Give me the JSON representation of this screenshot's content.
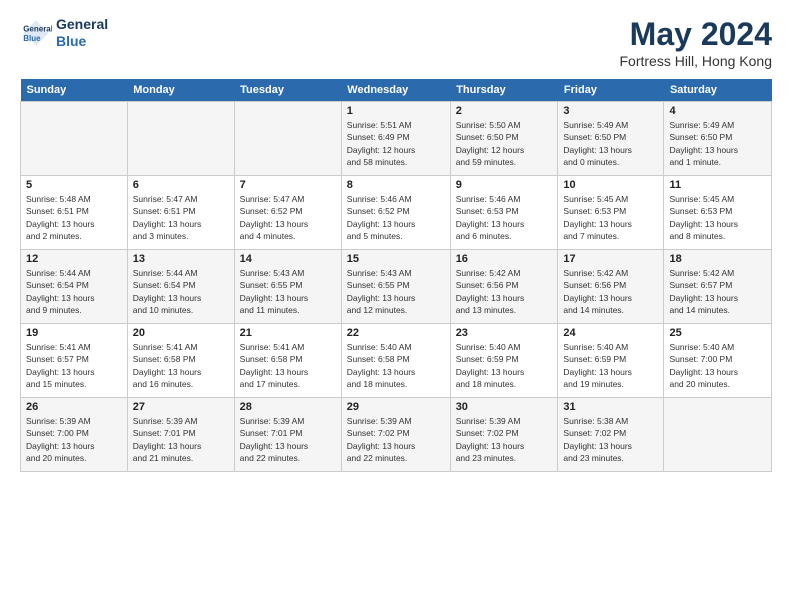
{
  "header": {
    "logo_line1": "General",
    "logo_line2": "Blue",
    "title": "May 2024",
    "location": "Fortress Hill, Hong Kong"
  },
  "weekdays": [
    "Sunday",
    "Monday",
    "Tuesday",
    "Wednesday",
    "Thursday",
    "Friday",
    "Saturday"
  ],
  "weeks": [
    [
      {
        "day": "",
        "info": ""
      },
      {
        "day": "",
        "info": ""
      },
      {
        "day": "",
        "info": ""
      },
      {
        "day": "1",
        "info": "Sunrise: 5:51 AM\nSunset: 6:49 PM\nDaylight: 12 hours\nand 58 minutes."
      },
      {
        "day": "2",
        "info": "Sunrise: 5:50 AM\nSunset: 6:50 PM\nDaylight: 12 hours\nand 59 minutes."
      },
      {
        "day": "3",
        "info": "Sunrise: 5:49 AM\nSunset: 6:50 PM\nDaylight: 13 hours\nand 0 minutes."
      },
      {
        "day": "4",
        "info": "Sunrise: 5:49 AM\nSunset: 6:50 PM\nDaylight: 13 hours\nand 1 minute."
      }
    ],
    [
      {
        "day": "5",
        "info": "Sunrise: 5:48 AM\nSunset: 6:51 PM\nDaylight: 13 hours\nand 2 minutes."
      },
      {
        "day": "6",
        "info": "Sunrise: 5:47 AM\nSunset: 6:51 PM\nDaylight: 13 hours\nand 3 minutes."
      },
      {
        "day": "7",
        "info": "Sunrise: 5:47 AM\nSunset: 6:52 PM\nDaylight: 13 hours\nand 4 minutes."
      },
      {
        "day": "8",
        "info": "Sunrise: 5:46 AM\nSunset: 6:52 PM\nDaylight: 13 hours\nand 5 minutes."
      },
      {
        "day": "9",
        "info": "Sunrise: 5:46 AM\nSunset: 6:53 PM\nDaylight: 13 hours\nand 6 minutes."
      },
      {
        "day": "10",
        "info": "Sunrise: 5:45 AM\nSunset: 6:53 PM\nDaylight: 13 hours\nand 7 minutes."
      },
      {
        "day": "11",
        "info": "Sunrise: 5:45 AM\nSunset: 6:53 PM\nDaylight: 13 hours\nand 8 minutes."
      }
    ],
    [
      {
        "day": "12",
        "info": "Sunrise: 5:44 AM\nSunset: 6:54 PM\nDaylight: 13 hours\nand 9 minutes."
      },
      {
        "day": "13",
        "info": "Sunrise: 5:44 AM\nSunset: 6:54 PM\nDaylight: 13 hours\nand 10 minutes."
      },
      {
        "day": "14",
        "info": "Sunrise: 5:43 AM\nSunset: 6:55 PM\nDaylight: 13 hours\nand 11 minutes."
      },
      {
        "day": "15",
        "info": "Sunrise: 5:43 AM\nSunset: 6:55 PM\nDaylight: 13 hours\nand 12 minutes."
      },
      {
        "day": "16",
        "info": "Sunrise: 5:42 AM\nSunset: 6:56 PM\nDaylight: 13 hours\nand 13 minutes."
      },
      {
        "day": "17",
        "info": "Sunrise: 5:42 AM\nSunset: 6:56 PM\nDaylight: 13 hours\nand 14 minutes."
      },
      {
        "day": "18",
        "info": "Sunrise: 5:42 AM\nSunset: 6:57 PM\nDaylight: 13 hours\nand 14 minutes."
      }
    ],
    [
      {
        "day": "19",
        "info": "Sunrise: 5:41 AM\nSunset: 6:57 PM\nDaylight: 13 hours\nand 15 minutes."
      },
      {
        "day": "20",
        "info": "Sunrise: 5:41 AM\nSunset: 6:58 PM\nDaylight: 13 hours\nand 16 minutes."
      },
      {
        "day": "21",
        "info": "Sunrise: 5:41 AM\nSunset: 6:58 PM\nDaylight: 13 hours\nand 17 minutes."
      },
      {
        "day": "22",
        "info": "Sunrise: 5:40 AM\nSunset: 6:58 PM\nDaylight: 13 hours\nand 18 minutes."
      },
      {
        "day": "23",
        "info": "Sunrise: 5:40 AM\nSunset: 6:59 PM\nDaylight: 13 hours\nand 18 minutes."
      },
      {
        "day": "24",
        "info": "Sunrise: 5:40 AM\nSunset: 6:59 PM\nDaylight: 13 hours\nand 19 minutes."
      },
      {
        "day": "25",
        "info": "Sunrise: 5:40 AM\nSunset: 7:00 PM\nDaylight: 13 hours\nand 20 minutes."
      }
    ],
    [
      {
        "day": "26",
        "info": "Sunrise: 5:39 AM\nSunset: 7:00 PM\nDaylight: 13 hours\nand 20 minutes."
      },
      {
        "day": "27",
        "info": "Sunrise: 5:39 AM\nSunset: 7:01 PM\nDaylight: 13 hours\nand 21 minutes."
      },
      {
        "day": "28",
        "info": "Sunrise: 5:39 AM\nSunset: 7:01 PM\nDaylight: 13 hours\nand 22 minutes."
      },
      {
        "day": "29",
        "info": "Sunrise: 5:39 AM\nSunset: 7:02 PM\nDaylight: 13 hours\nand 22 minutes."
      },
      {
        "day": "30",
        "info": "Sunrise: 5:39 AM\nSunset: 7:02 PM\nDaylight: 13 hours\nand 23 minutes."
      },
      {
        "day": "31",
        "info": "Sunrise: 5:38 AM\nSunset: 7:02 PM\nDaylight: 13 hours\nand 23 minutes."
      },
      {
        "day": "",
        "info": ""
      }
    ]
  ]
}
